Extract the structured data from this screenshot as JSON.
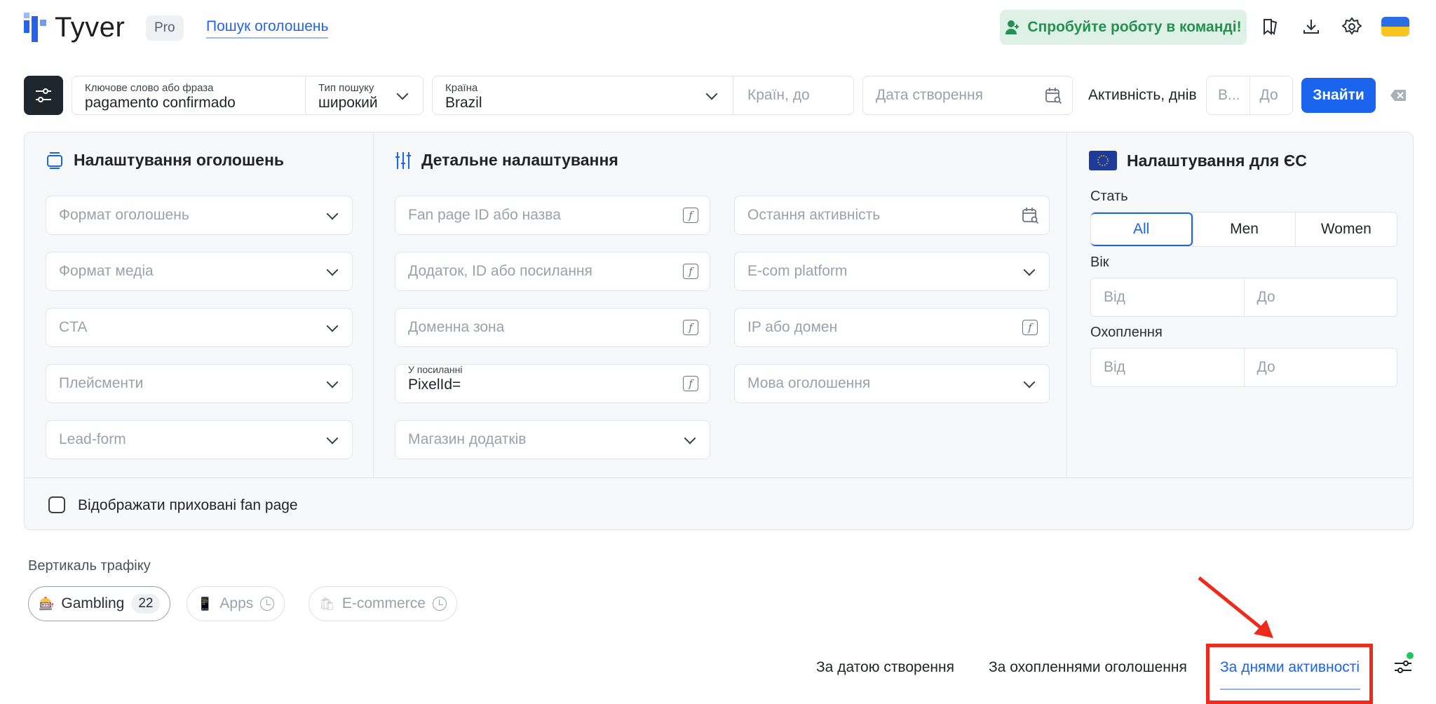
{
  "header": {
    "logo_text": "Tyver",
    "plan_badge": "Pro",
    "nav_link": "Пошук оголошень",
    "team_button": "Спробуйте роботу в команді!",
    "icons": [
      "bookmarks-icon",
      "download-icon",
      "settings-gear-icon",
      "ukraine-flag-icon"
    ]
  },
  "search": {
    "keyword_label": "Ключове слово або фраза",
    "keyword_value": "pagamento confirmado",
    "type_label": "Тип пошуку",
    "type_value": "широкий",
    "country_label": "Країна",
    "country_value": "Brazil",
    "countries_to_placeholder": "Країн, до",
    "date_placeholder": "Дата створення",
    "activity_label": "Активність, днів",
    "activity_from_placeholder": "В...",
    "activity_to_placeholder": "До",
    "find_button": "Знайти"
  },
  "ad_settings": {
    "title": "Налаштування оголошень",
    "fields": [
      "Формат оголошень",
      "Формат медіа",
      "CTA",
      "Плейсменти",
      "Lead-form"
    ]
  },
  "detailed": {
    "title": "Детальне налаштування",
    "left_fields": {
      "fanpage": "Fan page ID або назва",
      "app": "Додаток, ID або посилання",
      "domain_zone": "Доменна зона",
      "in_link_label": "У посиланні",
      "in_link_value": "PixelId=",
      "app_store": "Магазин додатків"
    },
    "right_fields": {
      "last_activity": "Остання активність",
      "ecom": "E-com platform",
      "ip_domain": "IP або домен",
      "ad_language": "Мова оголошення"
    }
  },
  "eu": {
    "title": "Налаштування для ЄС",
    "gender_label": "Стать",
    "gender_options": [
      "All",
      "Men",
      "Women"
    ],
    "gender_selected": "All",
    "age_label": "Вік",
    "age_from": "Від",
    "age_to": "До",
    "reach_label": "Охоплення",
    "reach_from": "Від",
    "reach_to": "До"
  },
  "hidden_fanpages_label": "Відображати приховані fan page",
  "traffic": {
    "label": "Вертикаль трафіку",
    "chips": [
      {
        "name": "Gambling",
        "count": "22",
        "icon": "slot-machine-icon"
      },
      {
        "name": "Apps",
        "icon": "phone-icon"
      },
      {
        "name": "E-commerce",
        "icon": "shopping-bags-icon"
      }
    ]
  },
  "sort_tabs": [
    "За датою створення",
    "За охопленнями оголошення",
    "За днями активності"
  ],
  "sort_active": "За днями активності",
  "colors": {
    "accent": "#1a64ee",
    "highlight": "#ee2b1a",
    "team_green": "#23914f",
    "dark": "#1f272e"
  }
}
